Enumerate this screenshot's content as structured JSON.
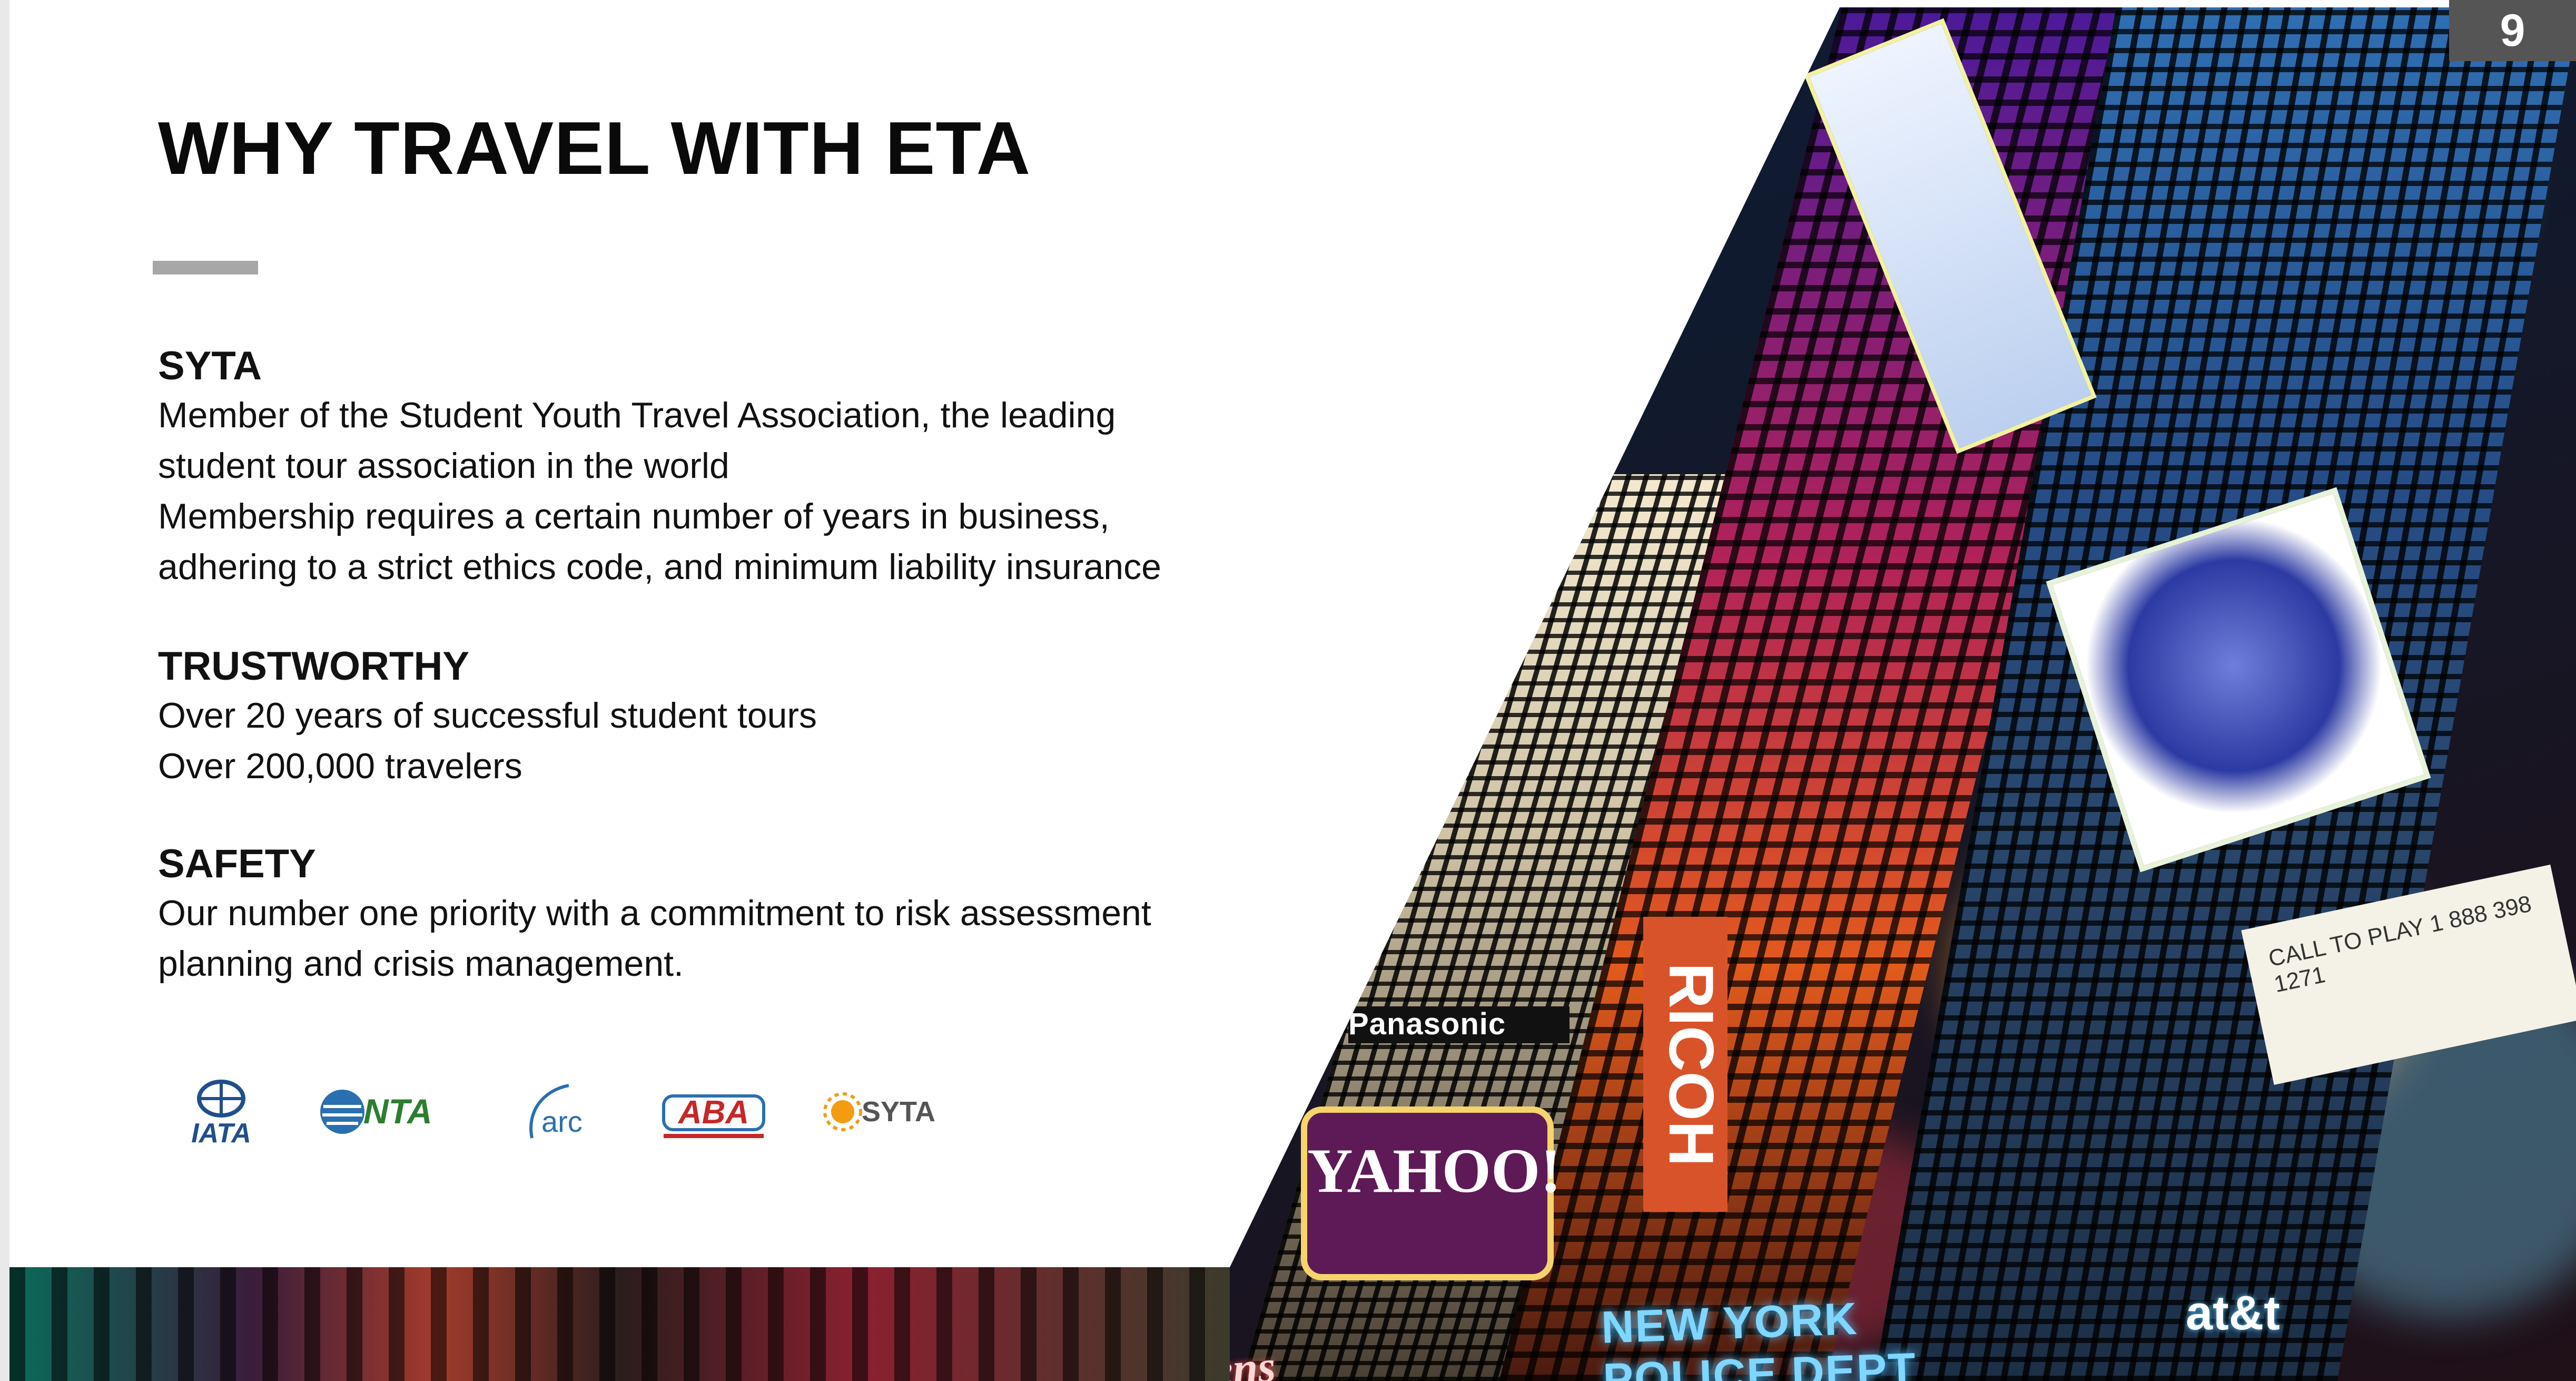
{
  "slide": {
    "page_number": "9",
    "title": "WHY TRAVEL WITH ETA",
    "sections": [
      {
        "heading": "SYTA",
        "lines": [
          "Member of the Student Youth Travel Association, the leading",
          "student tour association in the world",
          "Membership requires  a certain number of years in business,",
          "adhering to a strict ethics code, and minimum liability insurance"
        ]
      },
      {
        "heading": "TRUSTWORTHY",
        "lines": [
          "Over 20 years of successful student tours",
          "Over 200,000 travelers"
        ]
      },
      {
        "heading": "SAFETY",
        "lines": [
          "Our number one priority with a commitment to risk assessment",
          "planning and crisis management."
        ]
      }
    ],
    "logos": [
      "IATA",
      "NTA",
      "arc",
      "ABA",
      "SYTA"
    ],
    "photo_signs": {
      "ricoh": "RICOH",
      "panasonic": "Panasonic",
      "yahoo": "YAHOO!",
      "nypd": "NEW YORK POLICE DEPT",
      "att": "at&t",
      "walgreens": "Walgreens",
      "billboard_text": "CALL TO PLAY 1 888 398 1271"
    },
    "colors": {
      "title": "#0a0a0a",
      "rule": "#a7a7a7",
      "page_number_bg": "#555555",
      "iata": "#1f4f8c",
      "nta": "#2e7d32",
      "arc": "#2a6fb0",
      "aba": "#c62828",
      "syta": "#f39c12"
    }
  }
}
